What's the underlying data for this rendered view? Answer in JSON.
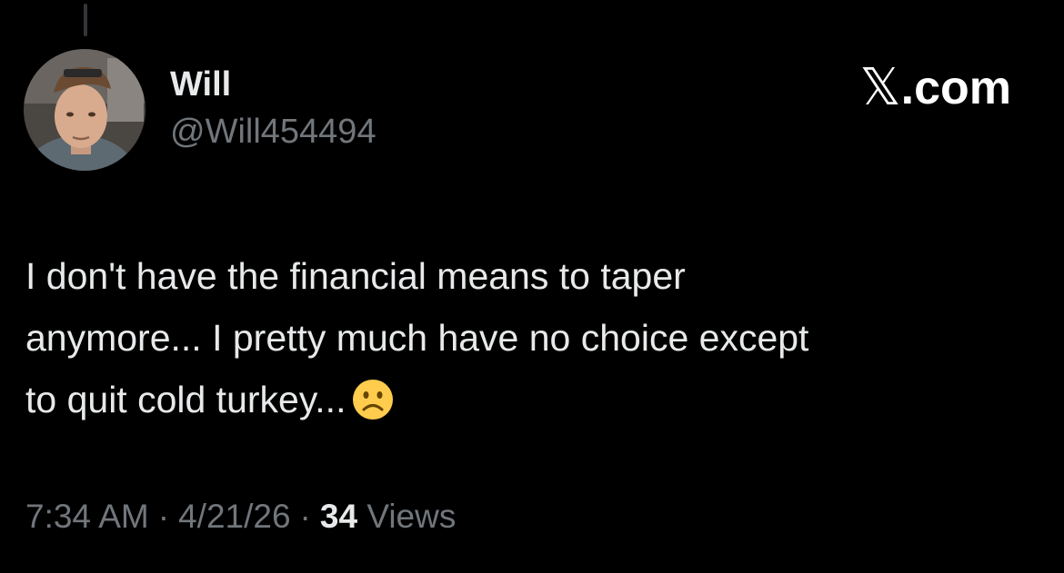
{
  "author": {
    "display_name": "Will",
    "handle": "@Will454494"
  },
  "site": {
    "wordmark": ".com",
    "icon": "x-logo-icon"
  },
  "tweet": {
    "lines": [
      "I don't have the financial means to taper",
      "anymore... I pretty much have no choice except",
      "to quit cold turkey..."
    ],
    "emoji": "slightly-frowning-face-icon"
  },
  "meta": {
    "time": "7:34 AM",
    "date": "4/21/26",
    "separator": "·",
    "views_count": "34",
    "views_label": "Views"
  },
  "colors": {
    "background": "#000000",
    "primary_text": "#e7e9ea",
    "secondary_text": "#71767b"
  }
}
